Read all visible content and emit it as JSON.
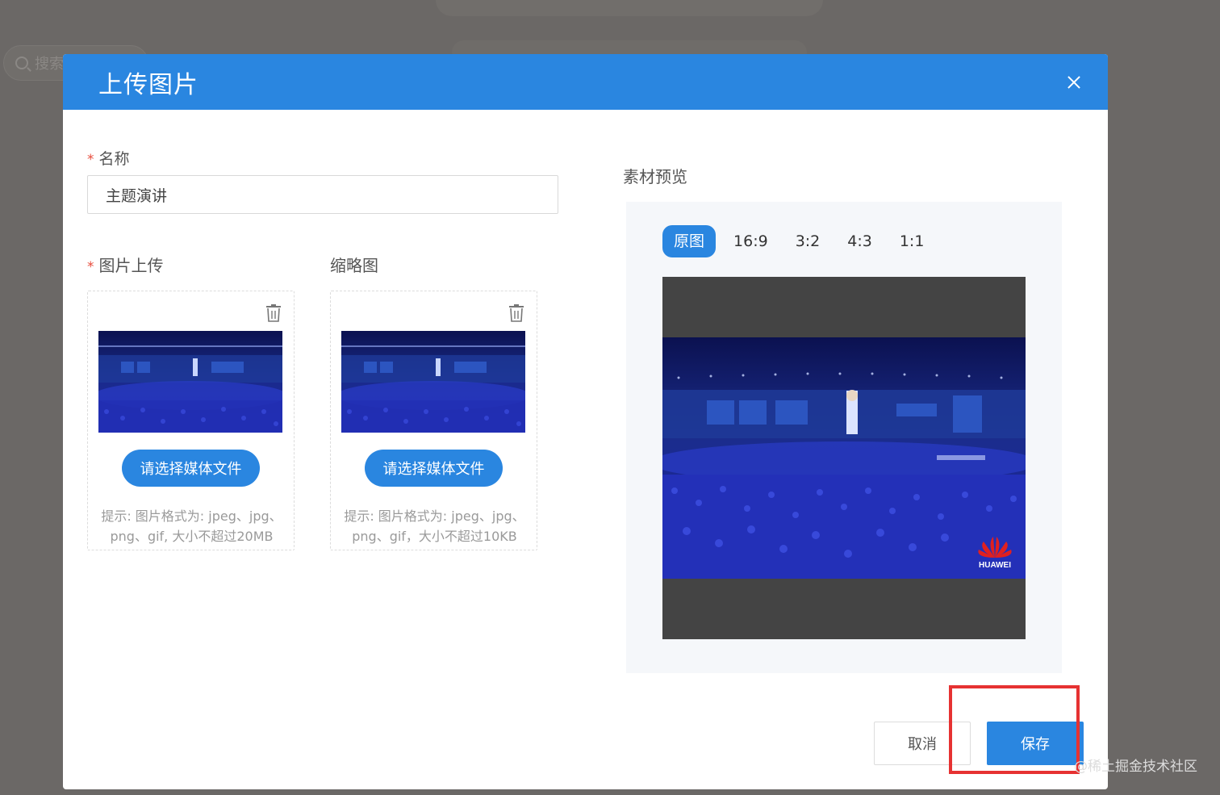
{
  "background": {
    "search_placeholder": "搜索"
  },
  "modal": {
    "title": "上传图片",
    "name_label": "名称",
    "required_mark": "*",
    "name_value": "主题演讲",
    "image_upload_label": "图片上传",
    "thumbnail_label": "缩略图",
    "upload_cards": [
      {
        "button_label": "请选择媒体文件",
        "hint_line1": "提示: 图片格式为: jpeg、jpg、",
        "hint_line2": "png、gif, 大小不超过20MB"
      },
      {
        "button_label": "请选择媒体文件",
        "hint_line1": "提示: 图片格式为: jpeg、jpg、",
        "hint_line2": "png、gif，大小不超过10KB"
      }
    ],
    "preview_title": "素材预览",
    "ratio_tabs": [
      "原图",
      "16:9",
      "3:2",
      "4:3",
      "1:1"
    ],
    "active_ratio": "原图",
    "preview_logo_text": "HUAWEI",
    "cancel_label": "取消",
    "save_label": "保存"
  },
  "watermark": "@稀土掘金技术社区",
  "colors": {
    "primary": "#2a86e0",
    "required": "#e74c3c",
    "highlight": "#e63232"
  },
  "icons": {
    "close": "close-icon",
    "delete": "trash-icon",
    "search": "search-icon"
  }
}
